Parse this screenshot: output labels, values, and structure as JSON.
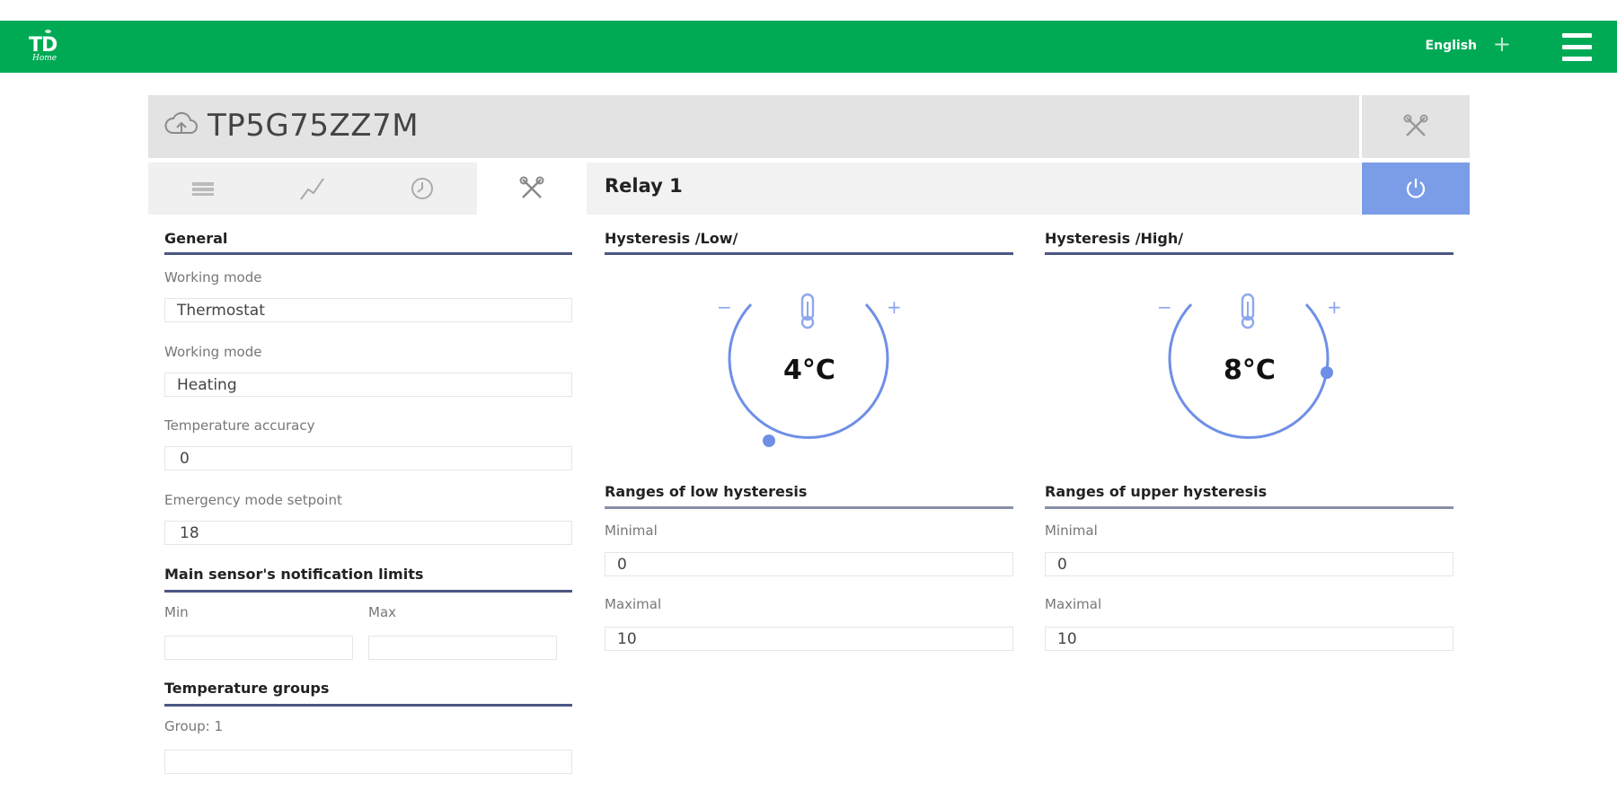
{
  "topbar": {
    "brand_initials": "TD",
    "brand_subtitle": "Home",
    "language": "English",
    "accent_color": "#00aa55"
  },
  "device": {
    "name": "TP5G75ZZ7M"
  },
  "relay": {
    "title": "Relay 1",
    "power_color": "#7b9de8"
  },
  "tabs": [
    {
      "icon": "list-icon",
      "active": false
    },
    {
      "icon": "chart-line-icon",
      "active": false
    },
    {
      "icon": "clock-icon",
      "active": false
    },
    {
      "icon": "tools-icon",
      "active": true
    }
  ],
  "general": {
    "title": "General",
    "working_mode_label": "Working mode",
    "working_mode_value": "Thermostat",
    "working_mode2_label": "Working mode",
    "working_mode2_value": "Heating",
    "temp_accuracy_label": "Temperature accuracy",
    "temp_accuracy_value": "0",
    "emergency_label": "Emergency mode setpoint",
    "emergency_value": "18"
  },
  "notification_limits": {
    "title": "Main sensor's notification limits",
    "min_label": "Min",
    "min_value": "",
    "max_label": "Max",
    "max_value": ""
  },
  "temperature_groups": {
    "title": "Temperature groups",
    "group_label": "Group: 1",
    "group_value": ""
  },
  "hysteresis_low": {
    "title": "Hysteresis /Low/",
    "value": "4°C",
    "minus": "−",
    "plus": "+",
    "ranges_title": "Ranges of low hysteresis",
    "minimal_label": "Minimal",
    "minimal_value": "0",
    "maximal_label": "Maximal",
    "maximal_value": "10"
  },
  "hysteresis_high": {
    "title": "Hysteresis /High/",
    "value": "8°C",
    "minus": "−",
    "plus": "+",
    "ranges_title": "Ranges of upper hysteresis",
    "minimal_label": "Minimal",
    "minimal_value": "0",
    "maximal_label": "Maximal",
    "maximal_value": "10"
  }
}
